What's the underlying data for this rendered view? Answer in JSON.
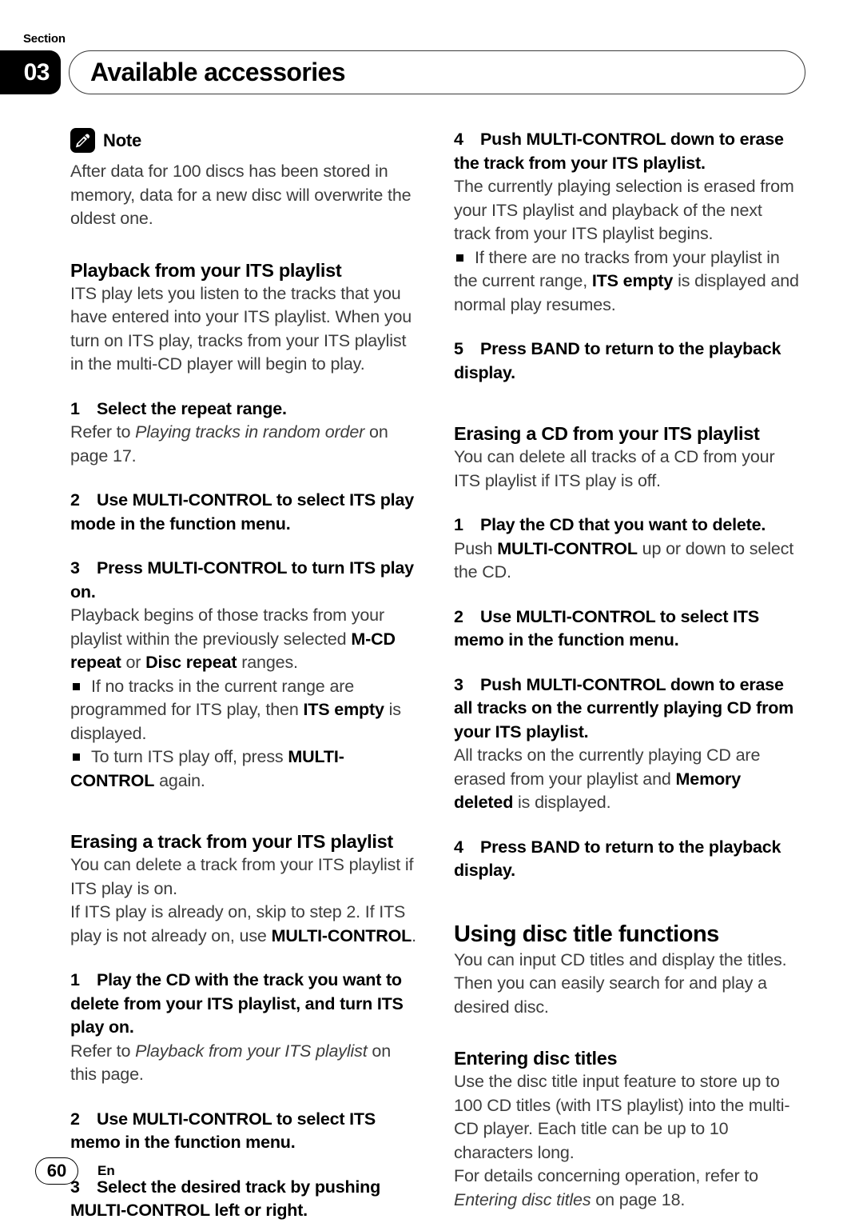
{
  "header": {
    "section_label": "Section",
    "section_number": "03",
    "title": "Available accessories"
  },
  "left_column": {
    "note": {
      "icon": "pencil-icon",
      "title": "Note",
      "body": "After data for 100 discs has been stored in memory, data for a new disc will overwrite the oldest one."
    },
    "playback_heading": "Playback from your ITS playlist",
    "playback_intro": "ITS play lets you listen to the tracks that you have entered into your ITS playlist. When you turn on ITS play, tracks from your ITS playlist in the multi-CD player will begin to play.",
    "step1_num": "1",
    "step1_text": "Select the repeat range.",
    "step1_body_pre": "Refer to ",
    "step1_body_italic": "Playing tracks in random order",
    "step1_body_post": " on page 17.",
    "step2_num": "2",
    "step2_text": "Use MULTI-CONTROL to select ITS play mode in the function menu.",
    "step3_num": "3",
    "step3_text": "Press MULTI-CONTROL to turn ITS play on.",
    "step3_body_pre": "Playback begins of those tracks from your playlist within the previously selected ",
    "step3_body_b1": "M-CD repeat",
    "step3_body_mid": " or ",
    "step3_body_b2": "Disc repeat",
    "step3_body_post": " ranges.",
    "bullet1_pre": "If no tracks in the current range are programmed for ITS play, then ",
    "bullet1_bold": "ITS empty",
    "bullet1_post": " is displayed.",
    "bullet2_pre": "To turn ITS play off, press ",
    "bullet2_bold": "MULTI-CONTROL",
    "bullet2_post": " again.",
    "erasing_track_heading": "Erasing a track from your ITS playlist",
    "erasing_track_p1": "You can delete a track from your ITS playlist if ITS play is on.",
    "erasing_track_p2_pre": "If ITS play is already on, skip to step 2. If ITS play is not already on, use ",
    "erasing_track_p2_bold": "MULTI-CONTROL",
    "erasing_track_p2_post": ".",
    "e_step1_num": "1",
    "e_step1_text": "Play the CD with the track you want to delete from your ITS playlist, and turn ITS play on.",
    "e_step1_body_pre": "Refer to ",
    "e_step1_body_italic": "Playback from your ITS playlist",
    "e_step1_body_post": " on this page.",
    "e_step2_num": "2",
    "e_step2_text": "Use MULTI-CONTROL to select ITS memo in the function menu.",
    "e_step3_num": "3",
    "e_step3_text": "Select the desired track by pushing MULTI-CONTROL left or right."
  },
  "right_column": {
    "r_step4_num": "4",
    "r_step4_text": "Push MULTI-CONTROL down to erase the track from your ITS playlist.",
    "r_step4_body": "The currently playing selection is erased from your ITS playlist and playback of the next track from your ITS playlist begins.",
    "r_bullet1_pre": "If there are no tracks from your playlist in the current range, ",
    "r_bullet1_bold": "ITS empty",
    "r_bullet1_post": " is displayed and normal play resumes.",
    "r_step5_num": "5",
    "r_step5_text": "Press BAND to return to the playback display.",
    "erasing_cd_heading": "Erasing a CD from your ITS playlist",
    "erasing_cd_intro": "You can delete all tracks of a CD from your ITS playlist if ITS play is off.",
    "c_step1_num": "1",
    "c_step1_text": "Play the CD that you want to delete.",
    "c_step1_body_pre": "Push ",
    "c_step1_body_bold": "MULTI-CONTROL",
    "c_step1_body_post": " up or down to select the CD.",
    "c_step2_num": "2",
    "c_step2_text": "Use MULTI-CONTROL to select ITS memo in the function menu.",
    "c_step3_num": "3",
    "c_step3_text": "Push MULTI-CONTROL down to erase all tracks on the currently playing CD from your ITS playlist.",
    "c_step3_body_pre": "All tracks on the currently playing CD are erased from your playlist and ",
    "c_step3_body_bold": "Memory deleted",
    "c_step3_body_post": " is displayed.",
    "c_step4_num": "4",
    "c_step4_text": "Press BAND to return to the playback display.",
    "disc_title_heading": "Using disc title functions",
    "disc_title_intro": "You can input CD titles and display the titles. Then you can easily search for and play a desired disc.",
    "entering_heading": "Entering disc titles",
    "entering_p1": "Use the disc title input feature to store up to 100 CD titles  (with ITS playlist) into the multi-CD player. Each title can be up to 10 characters long.",
    "entering_p2_pre": "For details concerning operation, refer to ",
    "entering_p2_italic": "Entering disc titles",
    "entering_p2_post": " on page 18."
  },
  "footer": {
    "page_number": "60",
    "language": "En"
  }
}
